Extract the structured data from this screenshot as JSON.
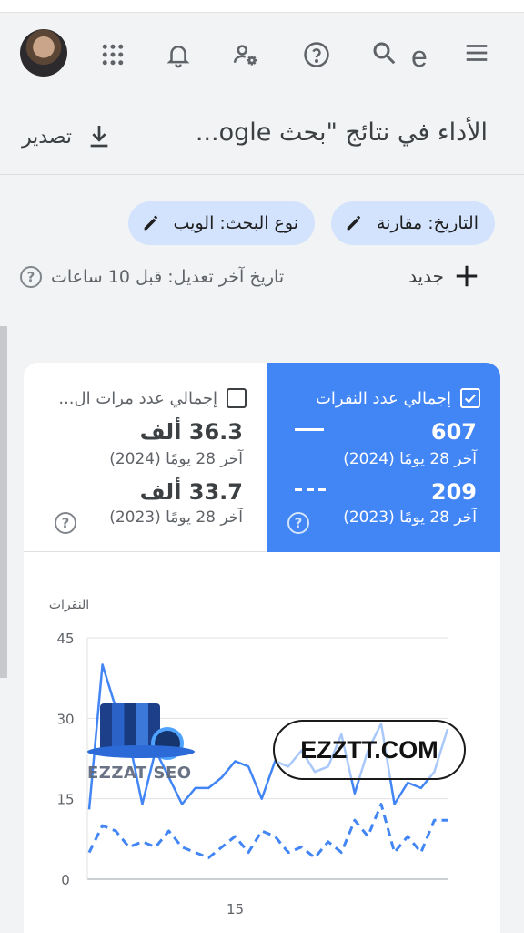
{
  "header": {
    "menu_icon": "menu-icon",
    "account_letter": "e",
    "icons": [
      "search-icon",
      "help-icon",
      "admin-icon",
      "bell-icon",
      "apps-icon",
      "avatar"
    ]
  },
  "titlebar": {
    "title": "الأداء في نتائج \"بحث ogle...",
    "export_label": "تصدير"
  },
  "filters": {
    "search_type": "نوع البحث: الويب",
    "date": "التاريخ: مقارنة"
  },
  "toolbar": {
    "new_label": "جديد",
    "last_modified": "تاريخ آخر تعديل: قبل 10 ساعات"
  },
  "metrics": {
    "clicks": {
      "title": "إجمالي عدد النقرات",
      "checked": true,
      "current_value": "607",
      "current_period": "آخر 28 يومًا (2024)",
      "previous_value": "209",
      "previous_period": "آخر 28 يومًا (2023)",
      "color": "#4285f4"
    },
    "impressions": {
      "title": "إجمالي عدد مرات ال...",
      "checked": false,
      "current_value": "36.3 ألف",
      "current_period": "آخر 28 يومًا (2024)",
      "previous_value": "33.7 ألف",
      "previous_period": "آخر 28 يومًا (2023)"
    }
  },
  "watermarks": {
    "logo_text": "EZZAT SEO",
    "site": "EZZTT.COM"
  },
  "chart_data": {
    "type": "line",
    "ylabel": "النقرات",
    "xlabel": "",
    "ylim": [
      0,
      45
    ],
    "yticks": [
      "0",
      "15",
      "30",
      "45"
    ],
    "xtick_label": "15",
    "xtick_index": 11,
    "grid": true,
    "series": [
      {
        "style": "solid",
        "color": "#4285f4",
        "values": [
          13,
          40,
          32,
          26,
          14,
          24,
          19,
          14,
          17,
          17,
          19,
          22,
          21,
          15,
          22,
          21,
          24,
          20,
          21,
          27,
          16,
          24,
          29,
          14,
          18,
          17,
          20,
          28
        ]
      },
      {
        "style": "dashed",
        "color": "#4285f4",
        "values": [
          5,
          10,
          9,
          6,
          7,
          6,
          9,
          6,
          5,
          4,
          6,
          8,
          5,
          9,
          8,
          5,
          6,
          4,
          7,
          5,
          11,
          8,
          14,
          5,
          8,
          5,
          11,
          11
        ]
      }
    ]
  }
}
